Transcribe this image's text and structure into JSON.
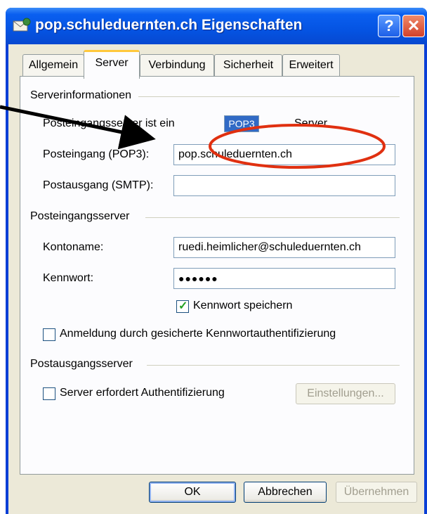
{
  "window": {
    "title": "pop.schuleduernten.ch Eigenschaften",
    "help_label": "?",
    "close_label": "✕"
  },
  "tabs": [
    {
      "label": "Allgemein"
    },
    {
      "label": "Server"
    },
    {
      "label": "Verbindung"
    },
    {
      "label": "Sicherheit"
    },
    {
      "label": "Erweitert"
    }
  ],
  "server_info": {
    "group_label": "Serverinformationen",
    "incoming_type_label": "Posteingangsserver ist ein",
    "incoming_type_value": "POP3",
    "incoming_type_suffix": "Server.",
    "incoming_label": "Posteingang (POP3):",
    "incoming_value": "pop.schuleduernten.ch",
    "outgoing_label": "Postausgang (SMTP):",
    "outgoing_value": ""
  },
  "incoming_server": {
    "group_label": "Posteingangsserver",
    "account_label": "Kontoname:",
    "account_value": "ruedi.heimlicher@schuleduernten.ch",
    "password_label": "Kennwort:",
    "password_value": "●●●●●●",
    "save_password_label": "Kennwort speichern",
    "save_password_checked": true,
    "spa_label": "Anmeldung durch gesicherte Kennwortauthentifizierung",
    "spa_checked": false
  },
  "outgoing_server": {
    "group_label": "Postausgangsserver",
    "auth_label": "Server erfordert Authentifizierung",
    "auth_checked": false,
    "settings_label": "Einstellungen..."
  },
  "buttons": {
    "ok": "OK",
    "cancel": "Abbrechen",
    "apply": "Übernehmen"
  },
  "annotation": {
    "arrow_color": "#000000",
    "ellipse_color": "#e03010"
  }
}
